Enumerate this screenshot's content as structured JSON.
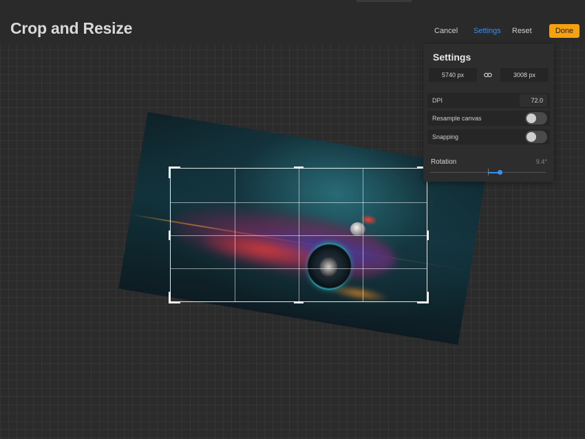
{
  "header": {
    "title": "Crop and Resize",
    "cancel_label": "Cancel",
    "settings_label": "Settings",
    "reset_label": "Reset",
    "done_label": "Done"
  },
  "settings": {
    "title": "Settings",
    "width": "5740 px",
    "height": "3008 px",
    "dpi_label": "DPI",
    "dpi_value": "72.0",
    "resample_label": "Resample canvas",
    "resample_on": false,
    "snapping_label": "Snapping",
    "snapping_on": false,
    "rotation_label": "Rotation",
    "rotation_value": "9.4°",
    "rotation_degrees": 9.4
  },
  "icons": {
    "link": "link-icon",
    "crop_handles": "crop-handle"
  },
  "colors": {
    "accent": "#3a8ff0",
    "done_button": "#f4a20e",
    "background": "#2b2b2b",
    "panel": "#2d2d2d"
  }
}
